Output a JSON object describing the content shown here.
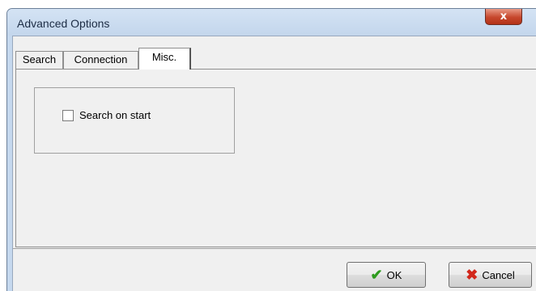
{
  "window": {
    "title": "Advanced Options",
    "close_glyph": "x"
  },
  "tabs": [
    {
      "label": "Search",
      "active": false
    },
    {
      "label": "Connection",
      "active": false
    },
    {
      "label": "Misc.",
      "active": true
    }
  ],
  "misc_panel": {
    "search_on_start": {
      "label": "Search on start",
      "checked": false
    }
  },
  "buttons": {
    "ok": {
      "label": "OK",
      "icon": "check-icon",
      "icon_color": "#2e9b1e"
    },
    "cancel": {
      "label": "Cancel",
      "icon": "x-mark-icon",
      "icon_color": "#d2281c"
    }
  },
  "colors": {
    "titlebar": "#c5d8ee",
    "close_button": "#c6472c",
    "client": "#f0f0f0"
  }
}
